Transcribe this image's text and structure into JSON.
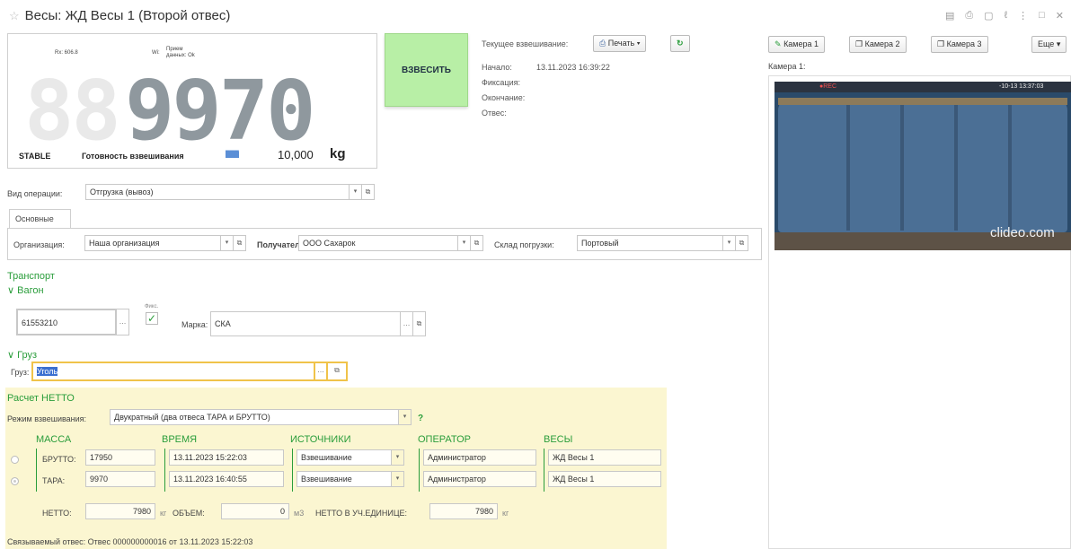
{
  "header": {
    "title": "Весы: ЖД Весы 1 (Второй отвес)"
  },
  "display": {
    "rx": "Rx: 606.8",
    "wi": "Wi:",
    "prev_data": "Прием",
    "prev_data2": "данных: Ok",
    "value": "9970",
    "bg_digits": "88",
    "status": "STABLE",
    "readiness": "Готовность взвешивания",
    "indicator": "███",
    "capacity": "10,000",
    "unit": "kg"
  },
  "weigh_button": "ВЗВЕСИТЬ",
  "current": {
    "label": "Текущее взвешивание:",
    "print": "Печать",
    "start_label": "Начало:",
    "start_value": "13.11.2023 16:39:22",
    "fix_label": "Фиксация:",
    "end_label": "Окончание:",
    "otves_label": "Отвес:"
  },
  "cameras": {
    "cam1": "Камера 1",
    "cam2": "Камера 2",
    "cam3": "Камера 3",
    "more": "Еще",
    "frame_label": "Камера 1:",
    "watermark": "clideo.com",
    "timestamp": "-10-13 13:37:03"
  },
  "operation": {
    "label": "Вид операции:",
    "value": "Отгрузка (вывоз)"
  },
  "tab": "Основные",
  "org": {
    "label": "Организация:",
    "value": "Наша организация",
    "recipient_label": "Получатель:",
    "recipient_value": "ООО Сахарок",
    "warehouse_label": "Склад погрузки:",
    "warehouse_value": "Портовый"
  },
  "transport": {
    "title": "Транспорт",
    "wagon": "Вагон",
    "number": "61553210",
    "fix_label": "Фикс.",
    "brand_label": "Марка:",
    "brand_value": "СКА"
  },
  "cargo": {
    "title": "Груз",
    "label": "Груз:",
    "value": "Уголь"
  },
  "netto": {
    "title": "Расчет НЕТТО",
    "mode_label": "Режим взвешивания:",
    "mode_value": "Двукратный (два отвеса ТАРА и БРУТТО)",
    "help": "?",
    "cols": [
      "МАССА",
      "ВРЕМЯ",
      "ИСТОЧНИКИ",
      "ОПЕРАТОР",
      "ВЕСЫ"
    ],
    "rows": [
      {
        "label": "БРУТТО:",
        "mass": "17950",
        "time": "13.11.2023 15:22:03",
        "source": "Взвешивание",
        "operator": "Администратор",
        "scales": "ЖД Весы 1"
      },
      {
        "label": "ТАРА:",
        "mass": "9970",
        "time": "13.11.2023 16:40:55",
        "source": "Взвешивание",
        "operator": "Администратор",
        "scales": "ЖД Весы 1"
      }
    ],
    "netto_label": "НЕТТО:",
    "netto_value": "7980",
    "kg": "кг",
    "volume_label": "ОБЪЕМ:",
    "volume_value": "0",
    "m3": "м3",
    "unit_label": "НЕТТО В УЧ.ЕДИНИЦЕ:",
    "unit_value": "7980",
    "unit_kg": "кг",
    "linked": "Связываемый отвес:  Отвес 000000000016 от 13.11.2023 15:22:03"
  }
}
